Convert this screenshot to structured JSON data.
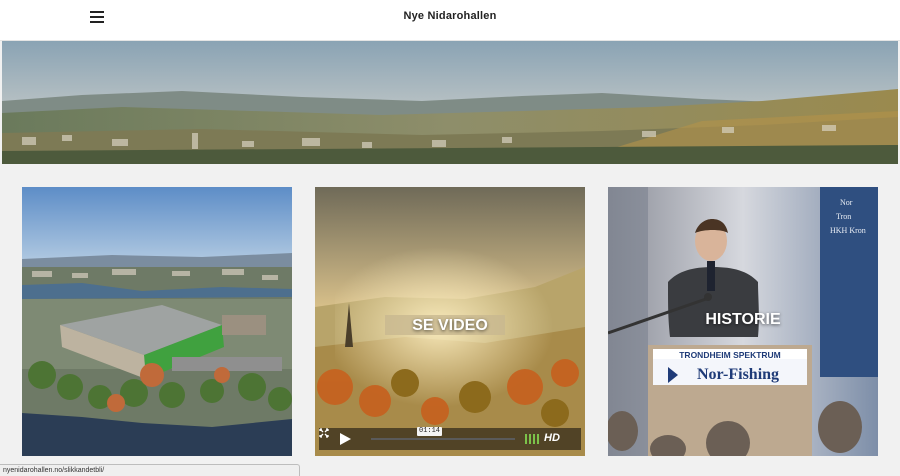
{
  "header": {
    "title": "Nye Nidarohallen",
    "menu_icon": "hamburger-menu-icon"
  },
  "banner": {
    "alt": "Trondheim panorama"
  },
  "cards": [
    {
      "name": "arena-rendering",
      "label": ""
    },
    {
      "name": "video",
      "label": "SE VIDEO"
    },
    {
      "name": "history",
      "label": "HISTORIE"
    }
  ],
  "video_player": {
    "time": "01:14",
    "hd_label": "HD",
    "play_icon": "play-icon",
    "volume_icon": "volume-icon",
    "fullscreen_icon": "fullscreen-icon"
  },
  "history_photo": {
    "podium_sign_line1": "TRONDHEIM SPEKTRUM",
    "podium_sign_line2": "Nor-Fishing",
    "banner_text": [
      "Nor",
      "Tron",
      "HKH Kron"
    ]
  },
  "status_bar": {
    "url": "nyenidarohallen.no/slikkandetbli/"
  }
}
